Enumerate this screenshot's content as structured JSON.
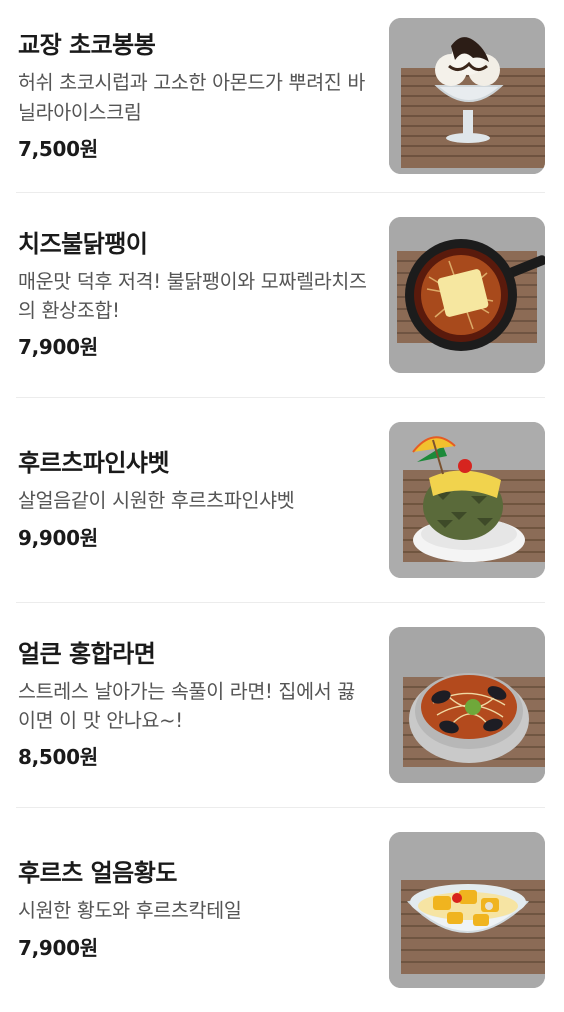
{
  "menu": [
    {
      "name": "교장 초코봉봉",
      "description": "허쉬 초코시럽과 고소한 아몬드가 뿌려진 바닐라아이스크림",
      "price": "7,500원",
      "image_icon": "chocolate-icecream-sundae"
    },
    {
      "name": "치즈불닭팽이",
      "description": "매운맛 덕후 저격! 불닭팽이와 모짜렐라치즈의 환상조합!",
      "price": "7,900원",
      "image_icon": "cheese-fire-chicken-mushroom-pan"
    },
    {
      "name": "후르츠파인샤벳",
      "description": "살얼음같이 시원한 후르츠파인샤벳",
      "price": "9,900원",
      "image_icon": "pineapple-sherbet"
    },
    {
      "name": "얼큰 홍합라면",
      "description": "스트레스 날아가는 속풀이 라면! 집에서 끓이면 이 맛 안나요~!",
      "price": "8,500원",
      "image_icon": "mussel-ramen-pot"
    },
    {
      "name": "후르츠 얼음황도",
      "description": "시원한 황도와 후르츠칵테일",
      "price": "7,900원",
      "image_icon": "iced-peach-fruit-bowl"
    }
  ]
}
